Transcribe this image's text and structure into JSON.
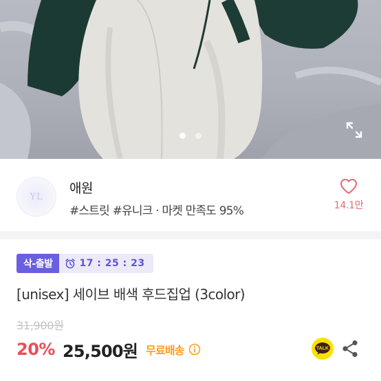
{
  "gallery": {
    "dot_count": 2,
    "active_index": 0,
    "expand_icon": "expand-icon"
  },
  "shop": {
    "logo_text": "YL",
    "name": "애원",
    "tags": "#스트릿 #유니크 · 마켓 만족도 95%",
    "like_icon": "heart-icon",
    "like_count": "14.1만"
  },
  "product": {
    "deal_badge": "삭-출발",
    "timer_icon": "alarm-clock-icon",
    "timer": "17 : 25 : 23",
    "title": "[unisex] 세이브 배색 후드집업 (3color)",
    "original_price": "31,900원",
    "discount": "20%",
    "price": "25,500원",
    "shipping": "무료배송",
    "shipping_info_icon": "info-icon",
    "talk_label": "TALK",
    "share_icon": "share-icon"
  },
  "colors": {
    "accent_purple": "#6a5fe0",
    "timer_bg": "#eceaf9",
    "discount_red": "#ea4e59",
    "like_pink": "#e36a74",
    "shipping_orange": "#ff9a1f",
    "talk_yellow": "#fae100"
  }
}
